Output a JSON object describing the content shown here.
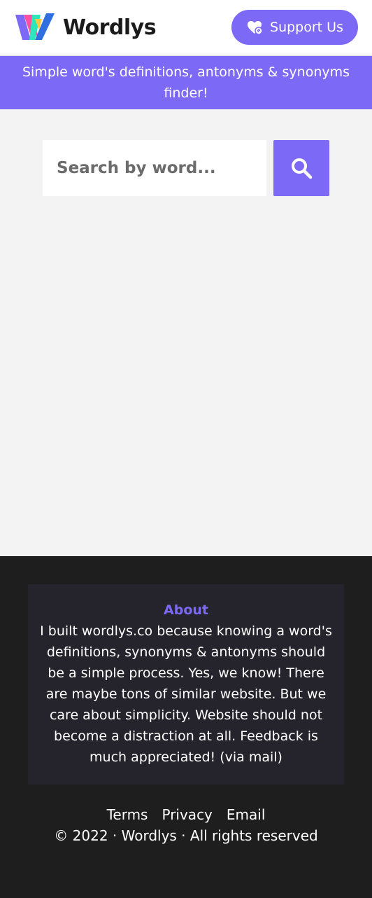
{
  "header": {
    "brand_name": "Wordlys",
    "support_label": "Support Us"
  },
  "tagline": "Simple word's definitions, antonyms & synonyms finder!",
  "search": {
    "placeholder": "Search by word..."
  },
  "about": {
    "title": "About",
    "text": "I built wordlys.co because knowing a word's definitions, synonyms & antonyms should be a simple process. Yes, we know! There are maybe tons of similar website. But we care about simplicity. Website should not become a distraction at all. Feedback is much appreciated! (via mail)"
  },
  "footer": {
    "links": [
      "Terms",
      "Privacy",
      "Email"
    ],
    "copyright": "© 2022 · Wordlys · All rights reserved"
  },
  "colors": {
    "accent": "#7c6af7",
    "footer_bg": "#1e1e1e",
    "about_bg": "#25242c"
  },
  "icons": [
    "wordlys-logo-icon",
    "heart-hand-icon",
    "search-icon"
  ]
}
